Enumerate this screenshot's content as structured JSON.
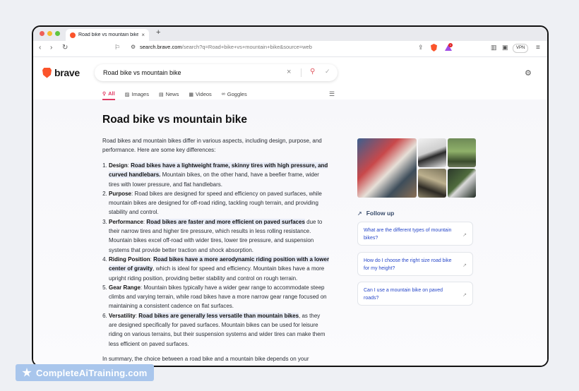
{
  "browser": {
    "tab_title": "Road bike vs mountain bike",
    "tab_close": "×",
    "new_tab": "+",
    "url_host": "search.brave.com",
    "url_path": "/search?q=Road+bike+vs+mountain+bike&source=web",
    "vpn_label": "VPN",
    "notification_count": "1"
  },
  "brave": {
    "logo_text": "brave",
    "search_query": "Road bike vs mountain bike",
    "nav_tabs": [
      {
        "label": "All",
        "icon": "search-icon"
      },
      {
        "label": "Images",
        "icon": "image-icon"
      },
      {
        "label": "News",
        "icon": "news-icon"
      },
      {
        "label": "Videos",
        "icon": "video-icon"
      },
      {
        "label": "Goggles",
        "icon": "goggles-icon"
      }
    ]
  },
  "answer": {
    "title": "Road bike vs mountain bike",
    "intro": "Road bikes and mountain bikes differ in various aspects, including design, purpose, and performance. Here are some key differences:",
    "items": [
      {
        "key": "Design",
        "highlight": "Road bikes have a lightweight frame, skinny tires with high pressure, and curved handlebars.",
        "rest": " Mountain bikes, on the other hand, have a beefier frame, wider tires with lower pressure, and flat handlebars."
      },
      {
        "key": "Purpose",
        "highlight": "",
        "rest": ": Road bikes are designed for speed and efficiency on paved surfaces, while mountain bikes are designed for off-road riding, tackling rough terrain, and providing stability and control."
      },
      {
        "key": "Performance",
        "highlight": "Road bikes are faster and more efficient on paved surfaces",
        "rest": " due to their narrow tires and higher tire pressure, which results in less rolling resistance. Mountain bikes excel off-road with wider tires, lower tire pressure, and suspension systems that provide better traction and shock absorption."
      },
      {
        "key": "Riding Position",
        "highlight": "Road bikes have a more aerodynamic riding position with a lower center of gravity",
        "rest": ", which is ideal for speed and efficiency. Mountain bikes have a more upright riding position, providing better stability and control on rough terrain."
      },
      {
        "key": "Gear Range",
        "highlight": "",
        "rest": ": Mountain bikes typically have a wider gear range to accommodate steep climbs and varying terrain, while road bikes have a more narrow gear range focused on maintaining a consistent cadence on flat surfaces."
      },
      {
        "key": "Versatility",
        "highlight": "Road bikes are generally less versatile than mountain bikes",
        "rest": ", as they are designed specifically for paved surfaces. Mountain bikes can be used for leisure riding on various terrains, but their suspension systems and wider tires can make them less efficient on paved surfaces."
      }
    ],
    "summary": "In summary, the choice between a road bike and a mountain bike depends on your"
  },
  "followup": {
    "heading": "Follow up",
    "questions": [
      "What are the different types of mountain bikes?",
      "How do I choose the right size road bike for my height?",
      "Can I use a mountain bike on paved roads?"
    ]
  },
  "watermark": {
    "text": "CompleteAiTraining.com"
  }
}
